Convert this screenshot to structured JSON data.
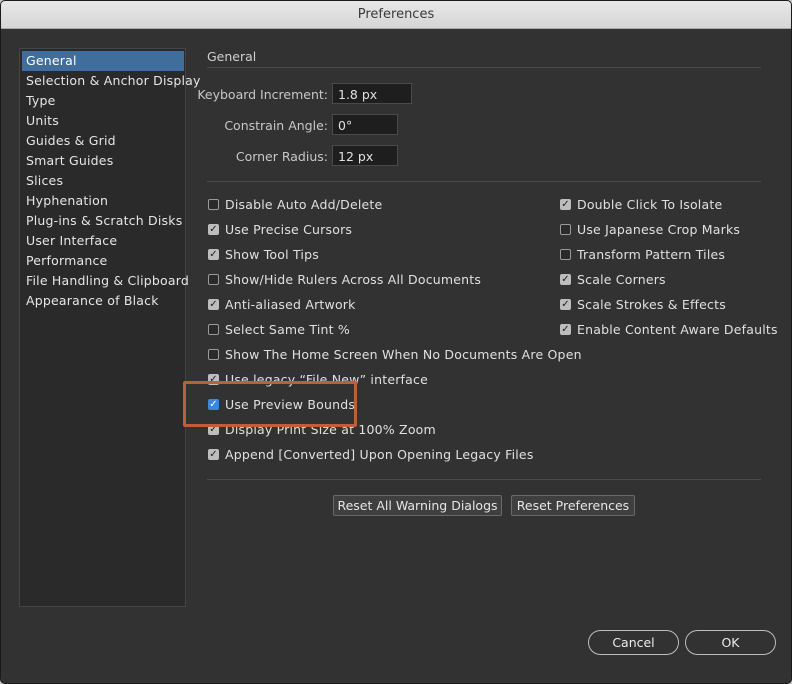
{
  "window": {
    "title": "Preferences"
  },
  "sidebar": {
    "items": [
      {
        "label": "General",
        "selected": true
      },
      {
        "label": "Selection & Anchor Display"
      },
      {
        "label": "Type"
      },
      {
        "label": "Units"
      },
      {
        "label": "Guides & Grid"
      },
      {
        "label": "Smart Guides"
      },
      {
        "label": "Slices"
      },
      {
        "label": "Hyphenation"
      },
      {
        "label": "Plug-ins & Scratch Disks"
      },
      {
        "label": "User Interface"
      },
      {
        "label": "Performance"
      },
      {
        "label": "File Handling & Clipboard"
      },
      {
        "label": "Appearance of Black"
      }
    ]
  },
  "general": {
    "title": "General",
    "fields": {
      "keyboard_increment": {
        "label": "Keyboard Increment:",
        "value": "1.8 px"
      },
      "constrain_angle": {
        "label": "Constrain Angle:",
        "value": "0°"
      },
      "corner_radius": {
        "label": "Corner Radius:",
        "value": "12 px"
      }
    },
    "left_options": [
      {
        "label": "Disable Auto Add/Delete",
        "checked": false
      },
      {
        "label": "Use Precise Cursors",
        "checked": true
      },
      {
        "label": "Show Tool Tips",
        "checked": true
      },
      {
        "label": "Show/Hide Rulers Across All Documents",
        "checked": false
      },
      {
        "label": "Anti-aliased Artwork",
        "checked": true
      },
      {
        "label": "Select Same Tint %",
        "checked": false
      },
      {
        "label": "Show The Home Screen When No Documents Are Open",
        "checked": false
      },
      {
        "label": "Use legacy “File New” interface",
        "checked": true
      },
      {
        "label": "Use Preview Bounds",
        "checked": true
      },
      {
        "label": "Display Print Size at 100% Zoom",
        "checked": true
      },
      {
        "label": "Append [Converted] Upon Opening Legacy Files",
        "checked": true
      }
    ],
    "right_options": [
      {
        "label": "Double Click To Isolate",
        "checked": true
      },
      {
        "label": "Use Japanese Crop Marks",
        "checked": false
      },
      {
        "label": "Transform Pattern Tiles",
        "checked": false
      },
      {
        "label": "Scale Corners",
        "checked": true
      },
      {
        "label": "Scale Strokes & Effects",
        "checked": true
      },
      {
        "label": "Enable Content Aware Defaults",
        "checked": true
      }
    ],
    "buttons": {
      "reset_warnings": "Reset All Warning Dialogs",
      "reset_preferences": "Reset Preferences"
    }
  },
  "footer": {
    "cancel": "Cancel",
    "ok": "OK"
  },
  "colors": {
    "panel_bg": "#323232",
    "selection": "#3f6e9c",
    "checkbox_accent": "#3c87dd",
    "highlight_annotation": "#bd5f3d"
  }
}
